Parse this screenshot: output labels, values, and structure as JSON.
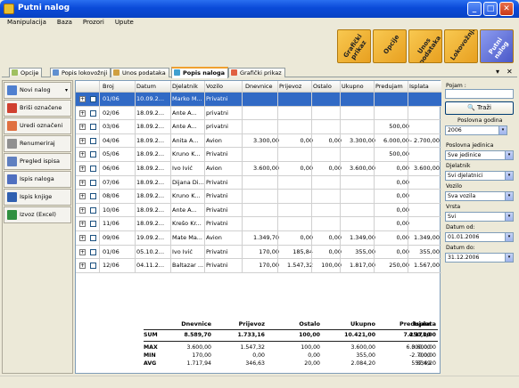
{
  "window": {
    "title": "Putni nalog"
  },
  "menu": [
    "Manipulacija",
    "Baza",
    "Prozori",
    "Upute"
  ],
  "toolbar": {
    "big_buttons": [
      "Grafički prikaz",
      "Opcije",
      "Unos podataka",
      "Lokovožnji",
      "Putni nalog"
    ]
  },
  "tabs": [
    "Opcije",
    "Popis lokovožnji",
    "Unos podataka",
    "Popis naloga",
    "Grafički prikaz"
  ],
  "tab_controls": {
    "dropdown": "▾",
    "close": "✕"
  },
  "left_actions": [
    {
      "label": "Novi nalog",
      "icon": "new-doc-icon",
      "dropdown": "▾"
    },
    {
      "label": "Briši označene",
      "icon": "delete-icon"
    },
    {
      "label": "Uredi označeni",
      "icon": "edit-icon"
    },
    {
      "label": "Renumeriraj",
      "icon": "renumber-icon"
    },
    {
      "label": "Pregled ispisa",
      "icon": "print-preview-icon"
    },
    {
      "label": "Ispis naloga",
      "icon": "print-icon"
    },
    {
      "label": "Ispis knjige",
      "icon": "book-icon"
    },
    {
      "label": "Izvoz (Excel)",
      "icon": "excel-icon"
    }
  ],
  "table": {
    "columns": [
      "Broj",
      "Datum",
      "Djelatnik",
      "Vozilo",
      "Dnevnice",
      "Prijevoz",
      "Ostalo",
      "Ukupno",
      "Predujam",
      "Isplata"
    ],
    "rows": [
      [
        "01/06",
        "10.09.2...",
        "Marko M...",
        "Privatni",
        "",
        "",
        "",
        "",
        "",
        ""
      ],
      [
        "02/06",
        "18.09.2...",
        "Ante A...",
        "privatni",
        "",
        "",
        "",
        "",
        "",
        ""
      ],
      [
        "03/06",
        "18.09.2...",
        "Ante A...",
        "privatni",
        "",
        "",
        "",
        "",
        "500,00",
        ""
      ],
      [
        "04/06",
        "18.09.2...",
        "Anita A...",
        "Avion",
        "3.300,00",
        "0,00",
        "0,00",
        "3.300,00",
        "6.000,00",
        "- 2.700,00"
      ],
      [
        "05/06",
        "18.09.2...",
        "Kruno K...",
        "Privatni",
        "",
        "",
        "",
        "",
        "500,00",
        ""
      ],
      [
        "06/06",
        "18.09.2...",
        "Ivo Ivić",
        "Avion",
        "3.600,00",
        "0,00",
        "0,00",
        "3.600,00",
        "0,00",
        "3.600,00"
      ],
      [
        "07/06",
        "18.09.2...",
        "Dijana Di...",
        "Privatni",
        "",
        "",
        "",
        "",
        "0,00",
        ""
      ],
      [
        "08/06",
        "18.09.2...",
        "Kruno K...",
        "Privatni",
        "",
        "",
        "",
        "",
        "0,00",
        ""
      ],
      [
        "10/06",
        "18.09.2...",
        "Ante A...",
        "Privatni",
        "",
        "",
        "",
        "",
        "0,00",
        ""
      ],
      [
        "11/06",
        "18.09.2...",
        "Krešo Kr...",
        "Privatni",
        "",
        "",
        "",
        "",
        "0,00",
        ""
      ],
      [
        "09/06",
        "19.09.2...",
        "Mate Ma...",
        "Avion",
        "1.349,70",
        "0,00",
        "0,00",
        "1.349,00",
        "0,00",
        "1.349,00"
      ],
      [
        "01/06",
        "05.10.2...",
        "Ivo Ivić",
        "Privatni",
        "170,00",
        "185,84",
        "0,00",
        "355,00",
        "0,00",
        "355,00"
      ],
      [
        "12/06",
        "04.11.2...",
        "Baltazar ...",
        "Privatni",
        "170,00",
        "1.547,32",
        "100,00",
        "1.817,00",
        "250,00",
        "1.567,00"
      ]
    ]
  },
  "summary": {
    "headers": [
      "Dnevnice",
      "Prijevoz",
      "Ostalo",
      "Ukupno",
      "Predujam",
      "Isplata"
    ],
    "rows": [
      {
        "label": "SUM",
        "values": [
          "8.589,70",
          "1.733,16",
          "100,00",
          "10.421,00",
          "7.250,00",
          "4.171,00"
        ]
      },
      {
        "label": "MAX",
        "values": [
          "3.600,00",
          "1.547,32",
          "100,00",
          "3.600,00",
          "6.000,00",
          "3.600,00"
        ]
      },
      {
        "label": "MIN",
        "values": [
          "170,00",
          "0,00",
          "0,00",
          "355,00",
          "0,00",
          "-2.700,00"
        ]
      },
      {
        "label": "AVG",
        "values": [
          "1.717,94",
          "346,63",
          "20,00",
          "2.084,20",
          "557,69",
          "834,20"
        ]
      }
    ]
  },
  "filters": {
    "pojam_label": "Pojam :",
    "pojam_value": "",
    "search_label": "Traži",
    "godina_label": "Poslovna godina",
    "godina_value": "2006",
    "jedinica_label": "Poslovna jedinica",
    "jedinica_value": "Sve jedinice",
    "djelatnik_label": "Djelatnik",
    "djelatnik_value": "Svi djelatnici",
    "vozilo_label": "Vozilo",
    "vozilo_value": "Sva vozila",
    "vrsta_label": "Vrsta",
    "vrsta_value": "Svi",
    "od_label": "Datum od:",
    "od_value": "01.01.2006",
    "do_label": "Datum do:",
    "do_value": "31.12.2006",
    "arrow": "▾"
  },
  "colors": {
    "accent": "#316ac5",
    "titlebar": "#0a4ad8",
    "toolbar_button": "#f0b030"
  }
}
